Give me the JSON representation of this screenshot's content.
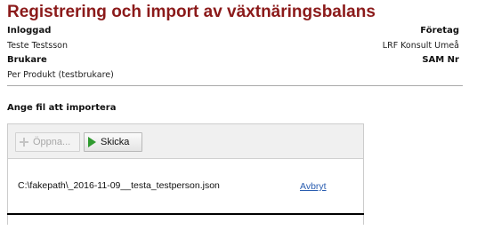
{
  "page": {
    "title": "Registrering och import av växtnäringsbalans"
  },
  "info": {
    "logged_in_label": "Inloggad",
    "logged_in_value": "Teste Testsson",
    "company_label": "Företag",
    "company_value": "LRF Konsult Umeå",
    "user_label": "Brukare",
    "user_value": "Per Produkt (testbrukare)",
    "sam_label": "SAM Nr"
  },
  "upload": {
    "section_label": "Ange fil att importera",
    "open_button": "Öppna...",
    "send_button": "Skicka",
    "file_name": "C:\\fakepath\\_2016-11-09__testa_testperson.json",
    "cancel_link": "Avbryt"
  }
}
